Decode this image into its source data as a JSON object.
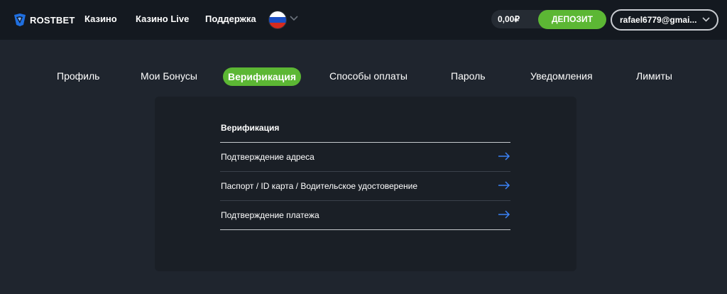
{
  "header": {
    "logo": {
      "brand": "ROSTBET"
    },
    "nav": [
      "Казино",
      "Казино Live",
      "Поддержка"
    ],
    "language_flag": "russia-flag-icon",
    "balance": "0,00₽",
    "deposit_label": "ДЕПОЗИТ",
    "user_email": "rafael6779@gmai..."
  },
  "tabs": [
    {
      "label": "Профиль"
    },
    {
      "label": "Мои Бонусы"
    },
    {
      "label": "Верификация",
      "active": true
    },
    {
      "label": "Способы оплаты"
    },
    {
      "label": "Пароль"
    },
    {
      "label": "Уведомления"
    },
    {
      "label": "Лимиты"
    }
  ],
  "verification": {
    "title": "Верификация",
    "items": [
      {
        "label": "Подтверждение адреса",
        "icon": "arrow-right-icon"
      },
      {
        "label": "Паспорт / ID карта / Водительское удостоверение",
        "icon": "arrow-right-icon"
      },
      {
        "label": "Подтверждение платежа",
        "icon": "arrow-right-icon"
      }
    ]
  },
  "colors": {
    "accent_green": "#5cb734",
    "header_bg": "#141920",
    "page_bg": "#1f252e",
    "card_bg": "#1a1f26",
    "arrow_blue": "#3b82f6"
  }
}
